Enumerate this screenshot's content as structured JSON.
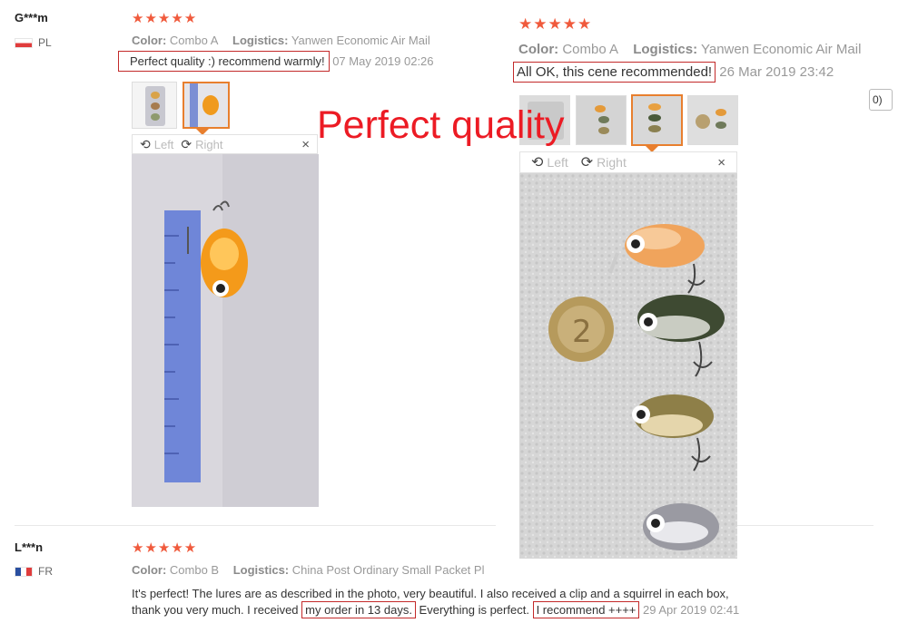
{
  "overlay_title": "Perfect quality",
  "rotate_left_label": "Left",
  "rotate_right_label": "Right",
  "close_glyph": "×",
  "corner_button_text": "0)",
  "colors": {
    "accent_star": "#f05a3c",
    "highlight_box": "#c32a2a",
    "overlay_text": "#ec1b24",
    "active_thumb": "#e87f2e"
  },
  "reviews": [
    {
      "reviewer": "G***m",
      "country": "PL",
      "stars": "★★★★★",
      "color_label": "Color:",
      "color_value": "Combo A",
      "logistics_label": "Logistics:",
      "logistics_value": "Yanwen Economic Air Mail",
      "text": "Perfect quality :) recommend warmly!",
      "date": "07 May 2019 02:26"
    },
    {
      "stars": "★★★★★",
      "color_label": "Color:",
      "color_value": "Combo A",
      "logistics_label": "Logistics:",
      "logistics_value": "Yanwen Economic Air Mail",
      "text": "All OK, this cene recommended!",
      "date": "26 Mar 2019 23:42"
    },
    {
      "reviewer": "L***n",
      "country": "FR",
      "stars": "★★★★★",
      "color_label": "Color:",
      "color_value": "Combo B",
      "logistics_label": "Logistics:",
      "logistics_value": "China Post Ordinary Small Packet Pl",
      "text_line1": "It's perfect! The lures are as described in the photo, very beautiful. I also received a clip and a squirrel in each box,",
      "text_line2_a": "thank you very much. I received ",
      "text_line2_box1": "my order in 13 days.",
      "text_line2_b": " Everything is perfect. ",
      "text_line2_box2": "I recommend ++++",
      "date": "29 Apr 2019 02:41"
    }
  ]
}
